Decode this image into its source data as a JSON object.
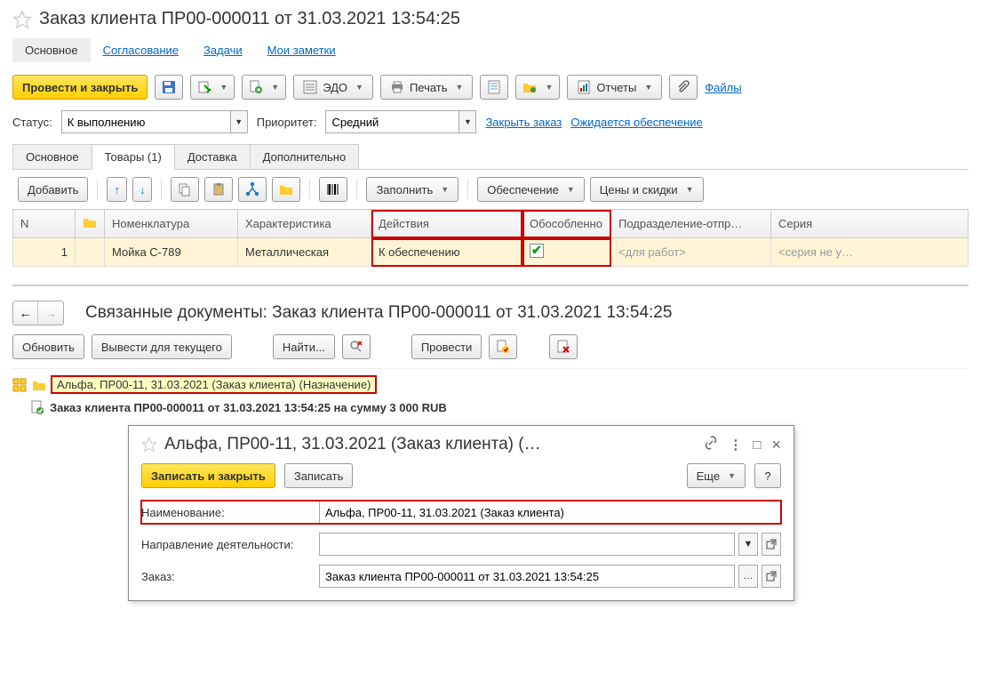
{
  "main": {
    "title": "Заказ клиента ПР00-000011 от 31.03.2021 13:54:25",
    "tabs": {
      "t1": "Основное",
      "t2": "Согласование",
      "t3": "Задачи",
      "t4": "Мои заметки"
    },
    "toolbar": {
      "post_close": "Провести и закрыть",
      "edo": "ЭДО",
      "print": "Печать",
      "reports": "Отчеты",
      "files": "Файлы"
    },
    "status": {
      "status_label": "Статус:",
      "status_value": "К выполнению",
      "priority_label": "Приоритет:",
      "priority_value": "Средний",
      "close_order": "Закрыть заказ",
      "awaiting_supply": "Ожидается обеспечение"
    },
    "subtabs": {
      "s1": "Основное",
      "s2": "Товары (1)",
      "s3": "Доставка",
      "s4": "Дополнительно"
    },
    "grid_toolbar": {
      "add": "Добавить",
      "fill": "Заполнить",
      "supply": "Обеспечение",
      "prices": "Цены и скидки"
    },
    "grid": {
      "headers": {
        "n": "N",
        "nomenclature": "Номенклатура",
        "characteristic": "Характеристика",
        "actions": "Действия",
        "separate": "Обособленно",
        "department": "Подразделение-отпр…",
        "series": "Серия"
      },
      "row": {
        "n": "1",
        "nomenclature": "Мойка С-789",
        "characteristic": "Металлическая",
        "actions": "К обеспечению",
        "department": "<для работ>",
        "series": "<серия не у…"
      }
    }
  },
  "related": {
    "title": "Связанные документы: Заказ клиента ПР00-000011 от 31.03.2021 13:54:25",
    "toolbar": {
      "refresh": "Обновить",
      "output_current": "Вывести для текущего",
      "find": "Найти...",
      "post": "Провести"
    },
    "tree": {
      "root": "Альфа, ПР00-11, 31.03.2021 (Заказ клиента) (Назначение)",
      "child": "Заказ клиента ПР00-000011 от 31.03.2021 13:54:25 на сумму 3 000 RUB"
    }
  },
  "popup": {
    "title": "Альфа, ПР00-11, 31.03.2021 (Заказ клиента) (…",
    "toolbar": {
      "save_close": "Записать и закрыть",
      "save": "Записать",
      "more": "Еще",
      "help": "?"
    },
    "fields": {
      "name_label": "Наименование:",
      "name_value": "Альфа, ПР00-11, 31.03.2021 (Заказ клиента)",
      "direction_label": "Направление деятельности:",
      "direction_value": "",
      "order_label": "Заказ:",
      "order_value": "Заказ клиента ПР00-000011 от 31.03.2021 13:54:25"
    }
  }
}
